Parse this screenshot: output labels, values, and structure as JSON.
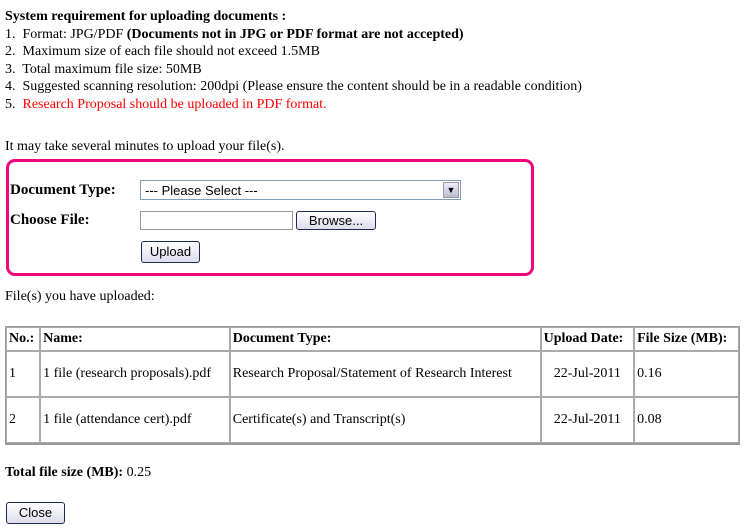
{
  "requirements": {
    "title": "System requirement for uploading documents :",
    "items": [
      {
        "num": "1.",
        "text": "Format: JPG/PDF ",
        "bold": "(Documents not in JPG or PDF format are not accepted)"
      },
      {
        "num": "2.",
        "text": "Maximum size of each file should not exceed 1.5MB"
      },
      {
        "num": "3.",
        "text": "Total maximum file size: 50MB"
      },
      {
        "num": "4.",
        "text": "Suggested scanning resolution: 200dpi (Please ensure the content should be in a readable condition)"
      },
      {
        "num": "5.",
        "text": "Research Proposal should be uploaded in PDF format."
      }
    ]
  },
  "note": "It may take several minutes to upload your file(s).",
  "form": {
    "doc_type_label": "Document Type:",
    "doc_type_value": "--- Please Select ---",
    "choose_file_label": "Choose File:",
    "file_value": "",
    "browse_label": "Browse...",
    "upload_label": "Upload"
  },
  "uploaded_label": "File(s) you have uploaded:",
  "table": {
    "headers": [
      "No.:",
      "Name:",
      "Document Type:",
      "Upload Date:",
      "File Size (MB):"
    ],
    "rows": [
      [
        "1",
        "1 file (research proposals).pdf",
        "Research Proposal/Statement of Research Interest",
        "22-Jul-2011",
        "0.16"
      ],
      [
        "2",
        "1 file (attendance cert).pdf",
        "Certificate(s) and Transcript(s)",
        "22-Jul-2011",
        "0.08"
      ]
    ]
  },
  "total": {
    "label": "Total file size (MB):",
    "value": " 0.25"
  },
  "close_label": "Close",
  "colors": {
    "highlight_border": "#f0067a",
    "warning": "#ff0000"
  }
}
